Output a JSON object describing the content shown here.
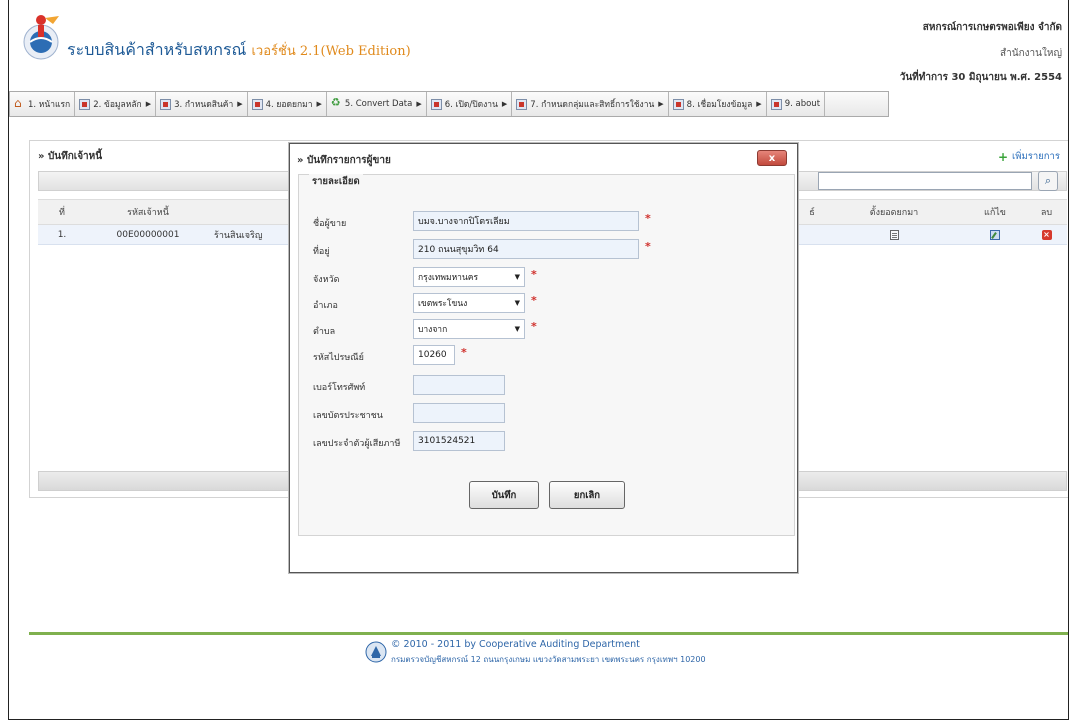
{
  "header": {
    "title": "ระบบสินค้าสำหรับสหกรณ์",
    "version": "เวอร์ชั่น 2.1(Web Edition)",
    "org_name": "สหกรณ์การเกษตรพอเพียง จำกัด",
    "branch": "สำนักงานใหญ่",
    "work_date": "วันที่ทำการ 30 มิถุนายน พ.ศ. 2554"
  },
  "menu": [
    {
      "label": "1. หน้าแรก",
      "arrow": ""
    },
    {
      "label": "2. ข้อมูลหลัก",
      "arrow": "▶"
    },
    {
      "label": "3. กำหนดสินค้า",
      "arrow": "▶"
    },
    {
      "label": "4. ยอดยกมา",
      "arrow": "▶"
    },
    {
      "label": "5. Convert Data",
      "arrow": "▶"
    },
    {
      "label": "6. เปิด/ปิดงาน",
      "arrow": "▶"
    },
    {
      "label": "7. กำหนดกลุ่มและสิทธิ์การใช้งาน",
      "arrow": "▶"
    },
    {
      "label": "8. เชื่อมโยงข้อมูล",
      "arrow": "▶"
    },
    {
      "label": "9. about",
      "arrow": ""
    }
  ],
  "panel": {
    "title": "» บันทึกเจ้าหนี้",
    "add_label": "เพิ่มรายการ",
    "search_value": "",
    "columns": {
      "no": "ที่",
      "code": "รหัสเจ้าหนี้",
      "extra": "ธ์",
      "balance": "ตั้งยอดยกมา",
      "edit": "แก้ไข",
      "delete": "ลบ"
    },
    "rows": [
      {
        "no": "1.",
        "code": "00E00000001",
        "name": "ร้านสินเจริญ"
      }
    ]
  },
  "modal": {
    "title": "» บันทึกรายการผู้ขาย",
    "close_label": "x",
    "legend": "รายละเอียด",
    "fields": {
      "seller_name": {
        "label": "ชื่อผู้ขาย",
        "value": "บมจ.บางจากปิโตรเลียม",
        "required": "*"
      },
      "address": {
        "label": "ที่อยู่",
        "value": "210 ถนนสุขุมวิท 64",
        "required": "*"
      },
      "province": {
        "label": "จังหวัด",
        "value": "กรุงเทพมหานคร",
        "required": "*"
      },
      "district": {
        "label": "อำเภอ",
        "value": "เขตพระโขนง",
        "required": "*"
      },
      "subdistrict": {
        "label": "ตำบล",
        "value": "บางจาก",
        "required": "*"
      },
      "postcode": {
        "label": "รหัสไปรษณีย์",
        "value": "10260",
        "required": "*"
      },
      "phone": {
        "label": "เบอร์โทรศัพท์",
        "value": ""
      },
      "citizen_id": {
        "label": "เลขบัตรประชาชน",
        "value": ""
      },
      "tax_id": {
        "label": "เลขประจำตัวผู้เสียภาษี",
        "value": "3101524521"
      }
    },
    "save_label": "บันทึก",
    "cancel_label": "ยกเลิก"
  },
  "footer": {
    "copyright": "© 2010 - 2011  by Cooperative Auditing Department",
    "address": "กรมตรวจบัญชีสหกรณ์ 12 ถนนกรุงเกษม แขวงวัดสามพระยา เขตพระนคร กรุงเทพฯ 10200"
  },
  "colors": {
    "accent_green": "#7fb04e",
    "title_blue": "#1e5a96",
    "version_orange": "#e08a1c",
    "required_red": "#d0312d",
    "link_blue": "#2a6ebb"
  }
}
